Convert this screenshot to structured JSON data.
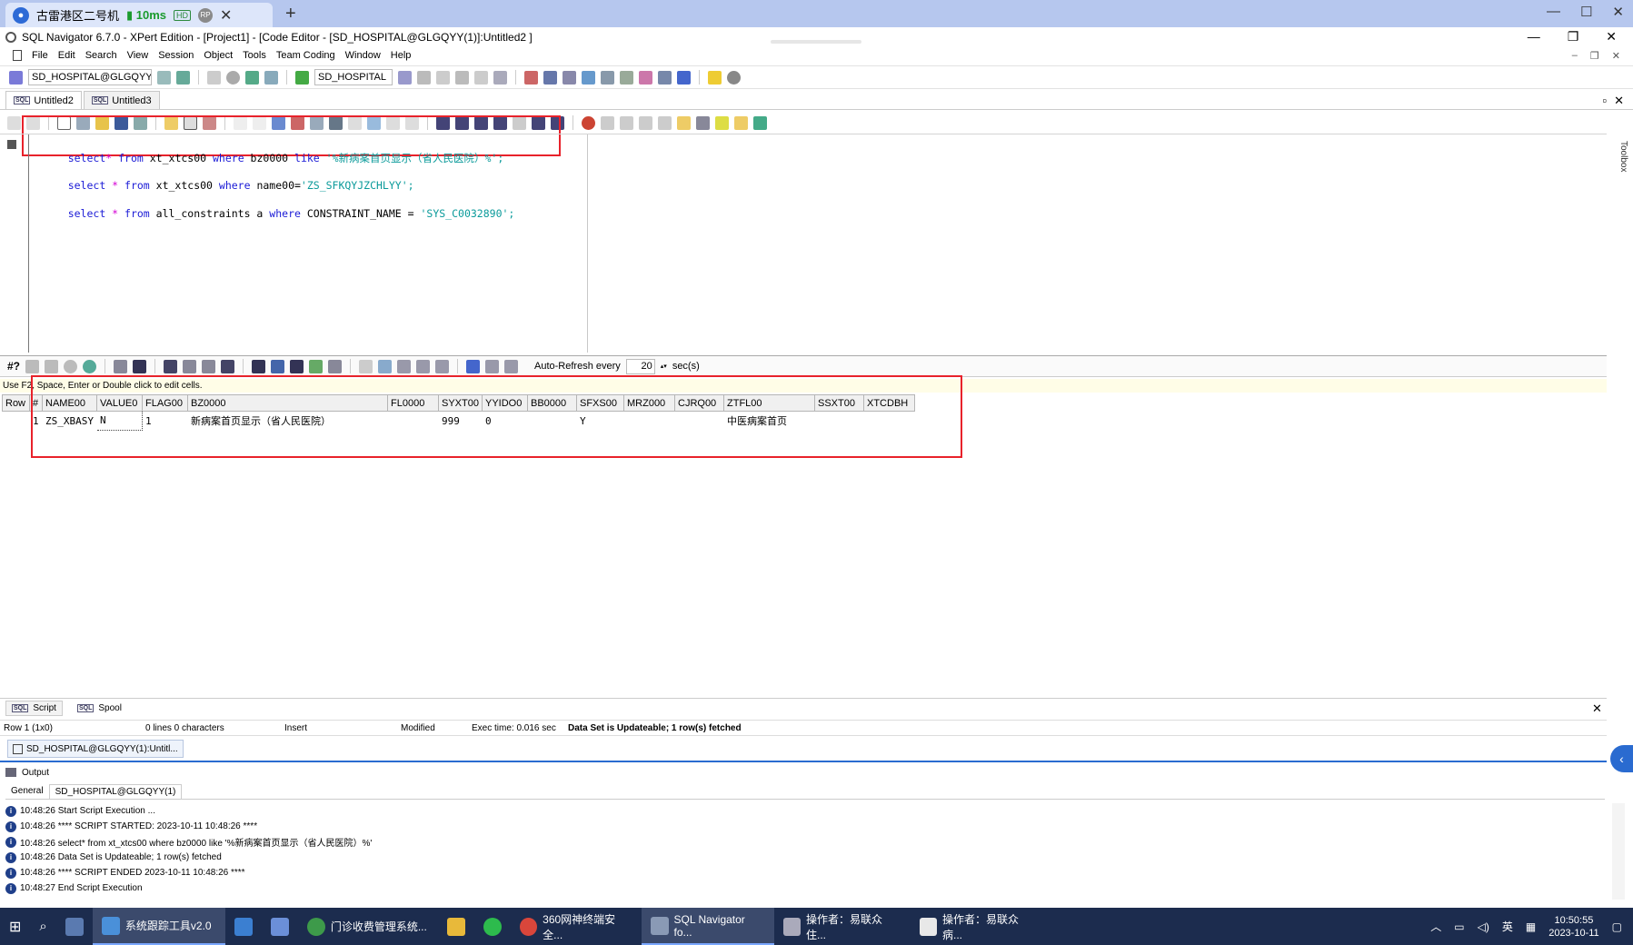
{
  "remote": {
    "tab_title": "古雷港区二号机",
    "ping": "10ms",
    "hd": "HD",
    "rp": "RP"
  },
  "window": {
    "title": "SQL Navigator 6.7.0 - XPert Edition - [Project1] - [Code Editor - [SD_HOSPITAL@GLGQYY(1)]:Untitled2 ]"
  },
  "menu": [
    "File",
    "Edit",
    "Search",
    "View",
    "Session",
    "Object",
    "Tools",
    "Team Coding",
    "Window",
    "Help"
  ],
  "toolbar": {
    "connection": "SD_HOSPITAL@GLGQYY(1)",
    "schema": "SD_HOSPITAL"
  },
  "editor_tabs": [
    "Untitled2",
    "Untitled3"
  ],
  "editor": {
    "lines": [
      {
        "kw1": "select",
        "op": "*",
        "kw2": "from",
        "tbl": " xt_xtcs00 ",
        "kw3": "where",
        "cond": " bz0000 ",
        "kw4": "like",
        "str": " '%新病案首页显示（省人民医院）%';"
      },
      {
        "kw1": "select",
        "op": " * ",
        "kw2": "from",
        "tbl": " xt_xtcs00 ",
        "kw3": "where",
        "cond": " name00=",
        "kw4": "",
        "str": "'ZS_SFKQYJZCHLYY';"
      },
      {
        "kw1": "select",
        "op": " * ",
        "kw2": "from",
        "tbl": " all_constraints a ",
        "kw3": "where",
        "cond": " CONSTRAINT_NAME = ",
        "kw4": "",
        "str": "'SYS_C0032890';"
      }
    ],
    "toolbox_label": "Toolbox"
  },
  "gridbar": {
    "hash": "#?",
    "auto_refresh_label": "Auto-Refresh every",
    "refresh_value": "20",
    "unit": "sec(s)"
  },
  "hint": "Use F2, Space, Enter or Double click to edit cells.",
  "grid": {
    "columns": [
      "Row",
      "#",
      "NAME00",
      "VALUE0",
      "FLAG00",
      "BZ0000",
      "FL0000",
      "SYXT00",
      "YYIDO0",
      "BB0000",
      "SFXS00",
      "MRZ000",
      "CJRQ00",
      "ZTFL00",
      "SSXT00",
      "XTCDBH"
    ],
    "rows": [
      [
        "",
        "1",
        "ZS_XBASY",
        "N",
        "1",
        "新病案首页显示（省人民医院）",
        "",
        "999",
        "0",
        "",
        "Y",
        "",
        "",
        "中医病案首页",
        "",
        ""
      ]
    ]
  },
  "bottom_tabs": [
    "Script",
    "Spool"
  ],
  "status": {
    "row": "Row 1 (1x0)",
    "lines": "0 lines 0 characters",
    "mode": "Insert",
    "modified": "Modified",
    "exec": "Exec time: 0.016 sec",
    "message": "Data Set is Updateable; 1 row(s) fetched"
  },
  "conn_tab": "SD_HOSPITAL@GLGQYY(1):Untitl...",
  "output": {
    "header": "Output",
    "tabs": [
      "General",
      "SD_HOSPITAL@GLGQYY(1)"
    ],
    "log": [
      "10:48:26  Start Script Execution ...",
      "10:48:26  **** SCRIPT STARTED: 2023-10-11 10:48:26 ****",
      "10:48:26  select* from xt_xtcs00 where bz0000 like '%新病案首页显示（省人民医院）%'",
      "10:48:26  Data Set is Updateable; 1 row(s) fetched",
      "10:48:26  **** SCRIPT ENDED 2023-10-11 10:48:26 ****",
      "10:48:27  End Script Execution"
    ]
  },
  "taskbar": {
    "items": [
      "系统跟踪工具v2.0",
      "门诊收费管理系统...",
      "360网神终端安全...",
      "SQL Navigator fo...",
      "操作者：易联众 住...",
      "操作者：易联众 病..."
    ],
    "ime": "英",
    "time": "10:50:55",
    "date": "2023-10-11"
  },
  "colors": {
    "keyword": "#1a1ad6",
    "string": "#0a9a9a",
    "highlight_box": "#e8222b",
    "taskbar": "#1c2c4e"
  }
}
